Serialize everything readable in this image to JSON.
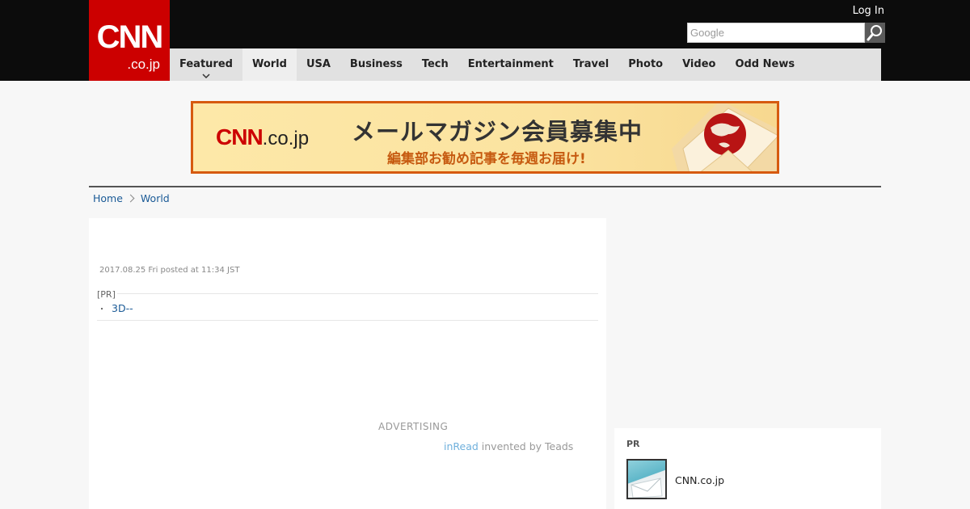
{
  "header": {
    "logo_main": "CNN",
    "logo_sub": ".co.jp",
    "login_label": "Log In",
    "search_placeholder": "Google"
  },
  "nav": {
    "tabs": [
      {
        "label": "Featured"
      },
      {
        "label": "World"
      },
      {
        "label": "USA"
      },
      {
        "label": "Business"
      },
      {
        "label": "Tech"
      },
      {
        "label": "Entertainment"
      },
      {
        "label": "Travel"
      },
      {
        "label": "Photo"
      },
      {
        "label": "Video"
      },
      {
        "label": "Odd News"
      }
    ]
  },
  "banner": {
    "logo_main": "CNN",
    "logo_sub": ".co.jp",
    "title": "メールマガジン会員募集中",
    "subtitle": "編集部お勧め記事を毎週お届け!"
  },
  "breadcrumb": {
    "home": "Home",
    "section": "World"
  },
  "article": {
    "posted": "2017.08.25 Fri posted at 11:34 JST",
    "pr_label": "[PR]",
    "pr_bullet": "・",
    "pr_link": "3D--",
    "advertising": "ADVERTISING",
    "inread_link": "inRead",
    "inread_text": " invented by Teads"
  },
  "sidebar": {
    "pr_label": "PR",
    "item_text": "CNN.co.jp"
  },
  "colors": {
    "brand_red": "#cc0000",
    "nav_bg": "#e1e1e1",
    "link_blue": "#1a5a96",
    "banner_border": "#d65a0f"
  }
}
